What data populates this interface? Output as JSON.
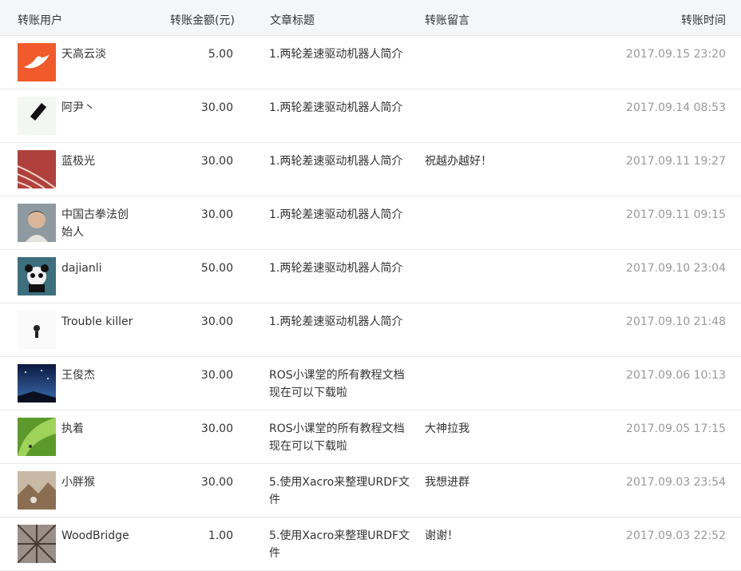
{
  "headers": {
    "user": "转账用户",
    "amount": "转账金额(元)",
    "title": "文章标题",
    "message": "转账留言",
    "time": "转账时间"
  },
  "rows": [
    {
      "user": "天高云淡",
      "amount": "5.00",
      "title": "1.两轮差速驱动机器人简介",
      "message": "",
      "time": "2017.09.15 23:20",
      "avatar": "bird-avatar"
    },
    {
      "user": "阿尹丶",
      "amount": "30.00",
      "title": "1.两轮差速驱动机器人简介",
      "message": "",
      "time": "2017.09.14 08:53",
      "avatar": "diamond-avatar"
    },
    {
      "user": "蓝极光",
      "amount": "30.00",
      "title": "1.两轮差速驱动机器人简介",
      "message": "祝越办越好！",
      "time": "2017.09.11 19:27",
      "avatar": "track-avatar"
    },
    {
      "user": "中国古拳法创始人",
      "amount": "30.00",
      "title": "1.两轮差速驱动机器人简介",
      "message": "",
      "time": "2017.09.11 09:15",
      "avatar": "portrait-avatar"
    },
    {
      "user": "dajianli",
      "amount": "50.00",
      "title": "1.两轮差速驱动机器人简介",
      "message": "",
      "time": "2017.09.10 23:04",
      "avatar": "panda-avatar"
    },
    {
      "user": "Trouble killer",
      "amount": "30.00",
      "title": "1.两轮差速驱动机器人简介",
      "message": "",
      "time": "2017.09.10 21:48",
      "avatar": "figure-avatar"
    },
    {
      "user": "王俊杰",
      "amount": "30.00",
      "title": "ROS小课堂的所有教程文档现在可以下载啦",
      "message": "",
      "time": "2017.09.06 10:13",
      "avatar": "night-sky-avatar"
    },
    {
      "user": "执着",
      "amount": "30.00",
      "title": "ROS小课堂的所有教程文档现在可以下载啦",
      "message": "大神拉我",
      "time": "2017.09.05 17:15",
      "avatar": "leaf-avatar"
    },
    {
      "user": "小胖猴",
      "amount": "30.00",
      "title": "5.使用Xacro来整理URDF文件",
      "message": "我想进群",
      "time": "2017.09.03 23:54",
      "avatar": "mountain-avatar"
    },
    {
      "user": "WoodBridge",
      "amount": "1.00",
      "title": "5.使用Xacro来整理URDF文件",
      "message": "谢谢！",
      "time": "2017.09.03 22:52",
      "avatar": "umbrella-avatar"
    }
  ]
}
